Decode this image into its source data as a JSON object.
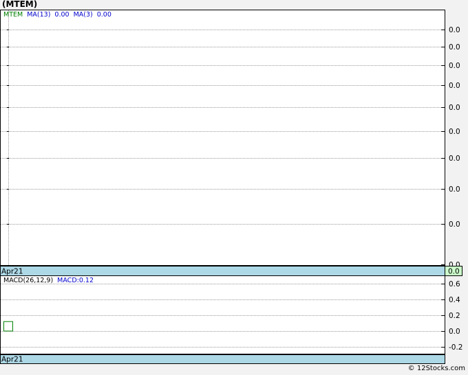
{
  "title": "(MTEM)",
  "footer": "© 12Stocks.com",
  "chart_data": [
    {
      "type": "line",
      "panel": "price",
      "legend": [
        {
          "text": "MTEM",
          "color": "#008000"
        },
        {
          "text": "MA(13)",
          "color": "#0000cc"
        },
        {
          "text": "0.00",
          "color": "#0000cc"
        },
        {
          "text": "MA(3)",
          "color": "#0000cc"
        },
        {
          "text": "0.00",
          "color": "#0000cc"
        }
      ],
      "y_tick_labels": [
        "0.0",
        "0.0",
        "0.0",
        "0.0",
        "0.0",
        "0.0",
        "0.0",
        "0.0",
        "0.0",
        "0.0"
      ],
      "last_value": "0.0",
      "x_tick_labels": [
        "Apr21"
      ],
      "series": [],
      "grid": true
    },
    {
      "type": "bar",
      "panel": "macd",
      "legend": [
        {
          "text": "MACD(26,12,9)",
          "color": "#000000"
        },
        {
          "text": "MACD:0.12",
          "color": "#0000cc"
        }
      ],
      "y_ticks": [
        0.6,
        0.4,
        0.2,
        0.0,
        -0.2
      ],
      "y_tick_labels": [
        "0.6",
        "0.4",
        "0.2",
        "0.0",
        "-0.2"
      ],
      "ylim": [
        -0.3,
        0.7
      ],
      "x_tick_labels": [
        "Apr21"
      ],
      "histogram": [
        {
          "x": "Apr21",
          "value": 0.12
        }
      ],
      "grid": true
    }
  ]
}
